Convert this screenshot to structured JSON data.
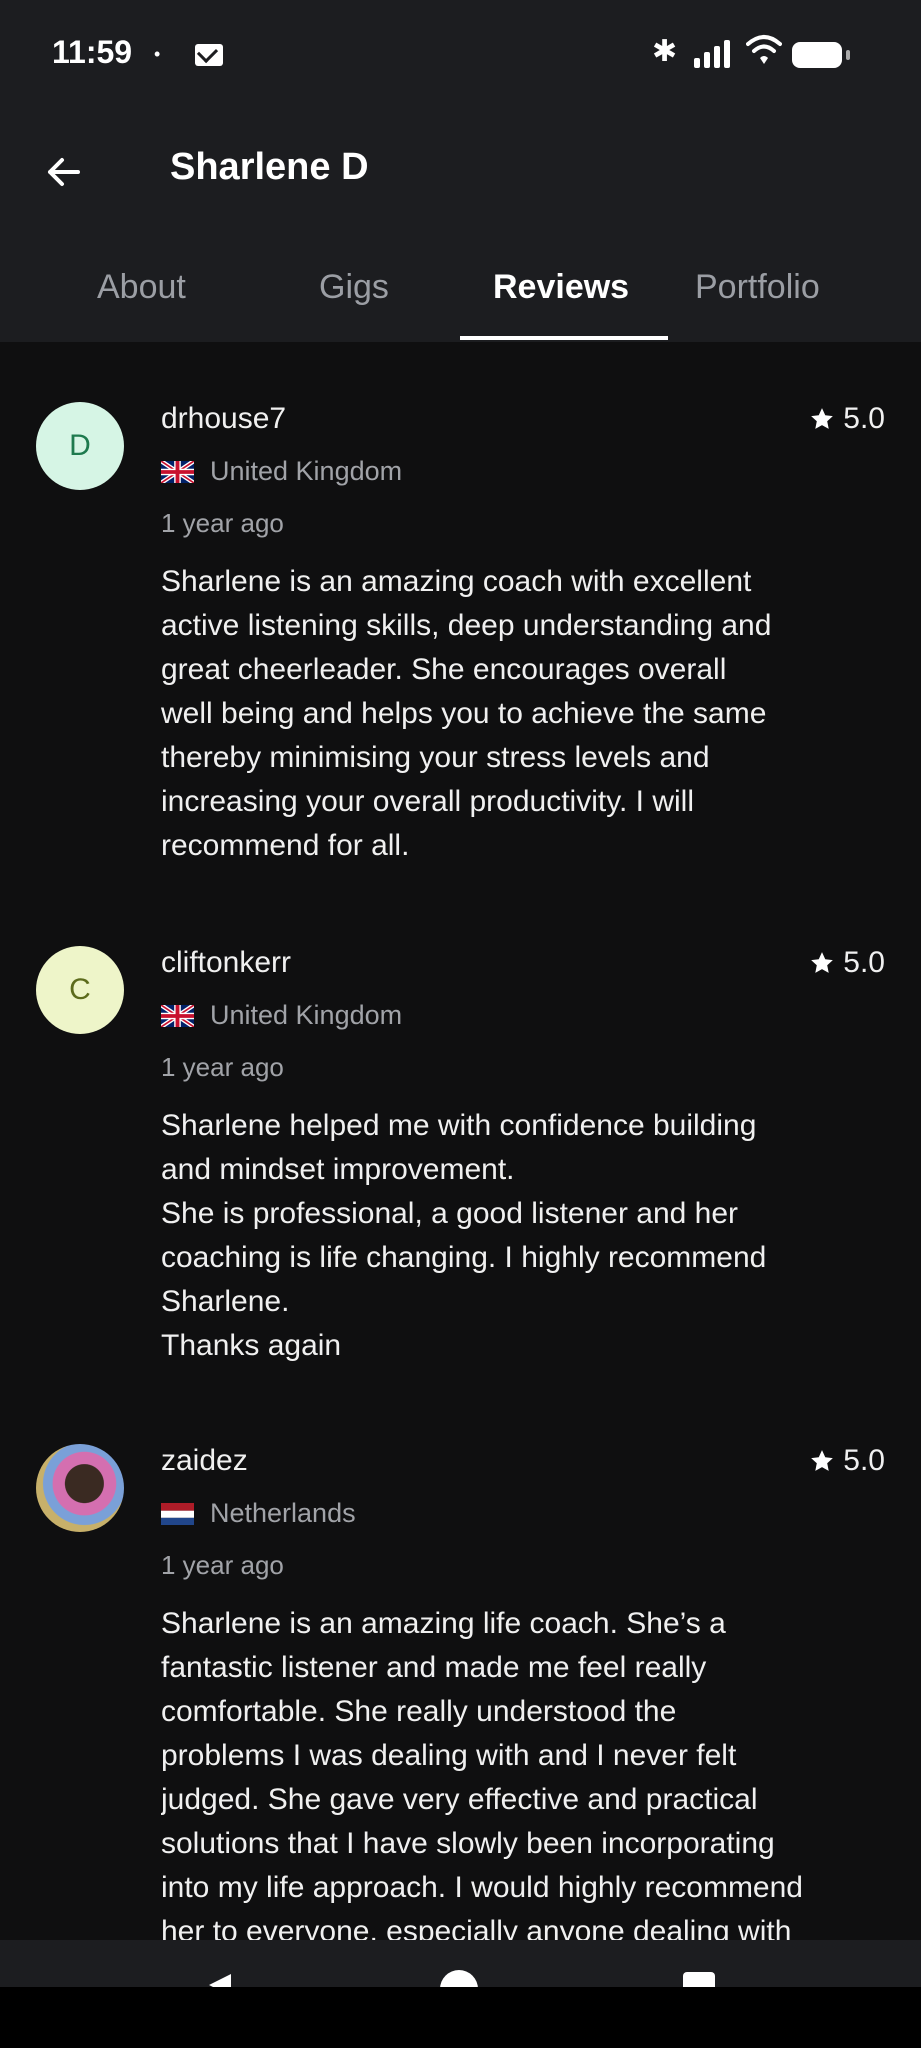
{
  "status_bar": {
    "time": "11:59",
    "dot": "•"
  },
  "header": {
    "title": "Sharlene D"
  },
  "tabs": [
    {
      "label": "About"
    },
    {
      "label": "Gigs"
    },
    {
      "label": "Reviews"
    },
    {
      "label": "Portfolio"
    }
  ],
  "reviews": [
    {
      "avatar_letter": "D",
      "avatar_color": "#d6f5e5",
      "username": "drhouse7",
      "rating": "5.0",
      "country": "United Kingdom",
      "flag": "uk-flag-icon",
      "time": "1 year ago",
      "text": "Sharlene is an amazing coach with excellent\nactive listening skills, deep understanding and\ngreat cheerleader. She encourages overall\nwell being and helps you to achieve the same\nthereby minimising your stress levels and\nincreasing your overall productivity. I will\nrecommend for all."
    },
    {
      "avatar_letter": "C",
      "avatar_color": "#eef5c9",
      "username": "cliftonkerr",
      "rating": "5.0",
      "country": "United Kingdom",
      "flag": "uk-flag-icon",
      "time": "1 year ago",
      "text": "Sharlene helped me with confidence building\nand mindset improvement.\nShe is professional, a good listener and her\ncoaching is life changing. I highly recommend\nSharlene.\nThanks again"
    },
    {
      "avatar_letter": "",
      "username": "zaidez",
      "rating": "5.0",
      "country": "Netherlands",
      "flag": "netherlands-flag-icon",
      "time": "1 year ago",
      "text": "Sharlene is an amazing life coach. She’s a\nfantastic listener and made me feel really\ncomfortable. She really understood the\nproblems I was dealing with and I never felt\njudged. She gave very effective and practical\nsolutions that I have slowly been incorporating\ninto my life approach. I would highly recommend\nher to everyone, especially anyone dealing with"
    }
  ]
}
